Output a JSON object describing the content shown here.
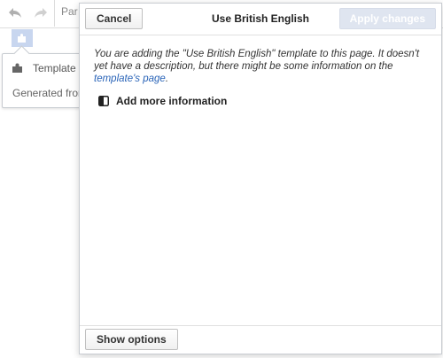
{
  "toolbar": {
    "format_label": "Par"
  },
  "context": {
    "tool_label": "Template",
    "generated_label": "Generated from:"
  },
  "dialog": {
    "title": "Use British English",
    "cancel_label": "Cancel",
    "apply_label": "Apply changes",
    "description_before": "You are adding the \"Use British English\" template to this page. It doesn't yet have a description, but there might be some information on the ",
    "description_link": "template's page",
    "description_after": ".",
    "add_more_label": "Add more information",
    "show_options_label": "Show options"
  },
  "colors": {
    "link": "#2a64b8",
    "apply_disabled_bg": "#dfe5f0",
    "node_highlight": "#c8d6ef"
  }
}
